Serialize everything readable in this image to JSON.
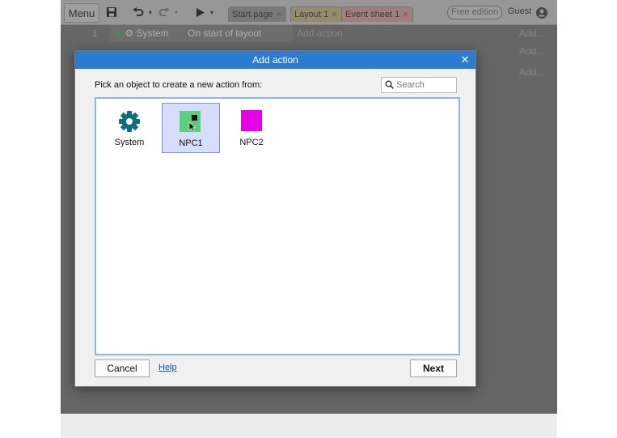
{
  "toolbar": {
    "menu_label": "Menu",
    "tabs": [
      {
        "label": "Start page",
        "color": "#a3a3a3"
      },
      {
        "label": "Layout 1",
        "color": "#d6c58f"
      },
      {
        "label": "Event sheet 1",
        "color": "#e7aab0"
      }
    ],
    "badge": "Free edition",
    "guest": "Guest"
  },
  "event_sheet": {
    "row_number": "1",
    "object": "System",
    "condition": "On start of layout",
    "add_action": "Add action",
    "add_labels": [
      "Add...",
      "Add...",
      "Add..."
    ]
  },
  "dialog": {
    "title": "Add action",
    "prompt": "Pick an object to create a new action from:",
    "search_placeholder": "Search",
    "objects": [
      {
        "name": "System",
        "icon": "gear-icon",
        "color": "#0e6e7e",
        "selected": false
      },
      {
        "name": "NPC1",
        "icon": "sprite-icon",
        "color": "#5bcf7c",
        "selected": true
      },
      {
        "name": "NPC2",
        "icon": "sprite-icon",
        "color": "#e600e6",
        "selected": false
      }
    ],
    "cancel_label": "Cancel",
    "help_label": "Help",
    "next_label": "Next"
  },
  "colors": {
    "title_bar": "#2b7bd1",
    "selection": "#d6ddff"
  }
}
